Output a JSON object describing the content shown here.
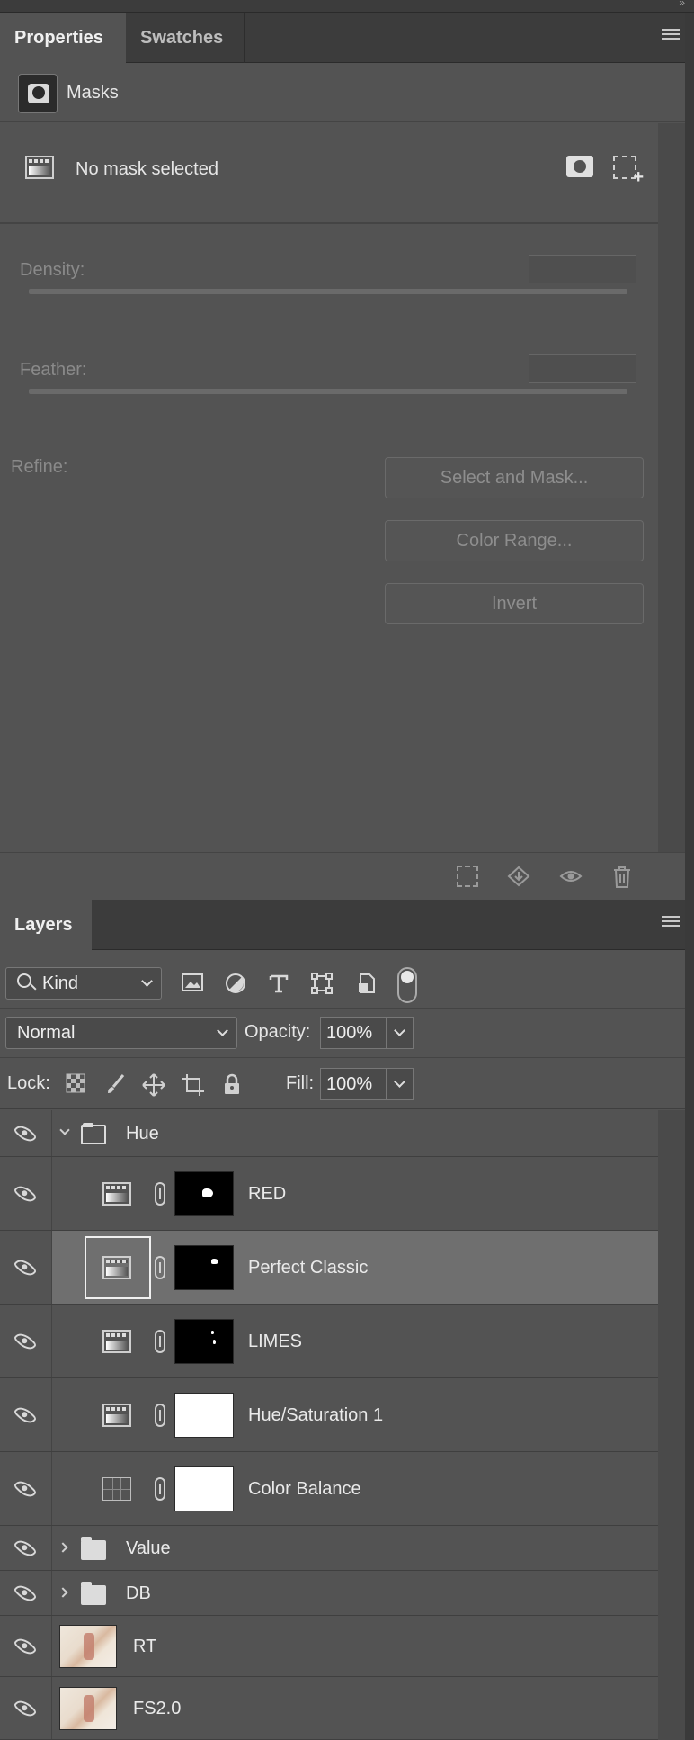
{
  "properties_panel": {
    "tabs": [
      {
        "label": "Properties",
        "active": true
      },
      {
        "label": "Swatches",
        "active": false
      }
    ],
    "section_label": "Masks",
    "no_mask_text": "No mask selected",
    "density_label": "Density:",
    "feather_label": "Feather:",
    "refine_label": "Refine:",
    "buttons": {
      "select_and_mask": "Select and Mask...",
      "color_range": "Color Range...",
      "invert": "Invert"
    }
  },
  "layers_panel": {
    "tab_label": "Layers",
    "filter": {
      "kind_label": "Kind"
    },
    "blend_mode": "Normal",
    "opacity_label": "Opacity:",
    "opacity_value": "100%",
    "lock_label": "Lock:",
    "fill_label": "Fill:",
    "fill_value": "100%",
    "layers": [
      {
        "name": "Hue",
        "type": "group",
        "expanded": true
      },
      {
        "name": "RED",
        "type": "adjustment"
      },
      {
        "name": "Perfect Classic",
        "type": "adjustment",
        "selected": true
      },
      {
        "name": "LIMES",
        "type": "adjustment"
      },
      {
        "name": "Hue/Saturation 1",
        "type": "adjustment"
      },
      {
        "name": "Color Balance",
        "type": "adjustment"
      },
      {
        "name": "Value",
        "type": "group",
        "expanded": false
      },
      {
        "name": "DB",
        "type": "group",
        "expanded": false
      },
      {
        "name": "RT",
        "type": "pixel"
      },
      {
        "name": "FS2.0",
        "type": "pixel"
      }
    ]
  },
  "colors": {
    "panel_bg": "#535353",
    "tab_bar_bg": "#3c3c3c",
    "selected_row_bg": "#6f6f6f"
  }
}
